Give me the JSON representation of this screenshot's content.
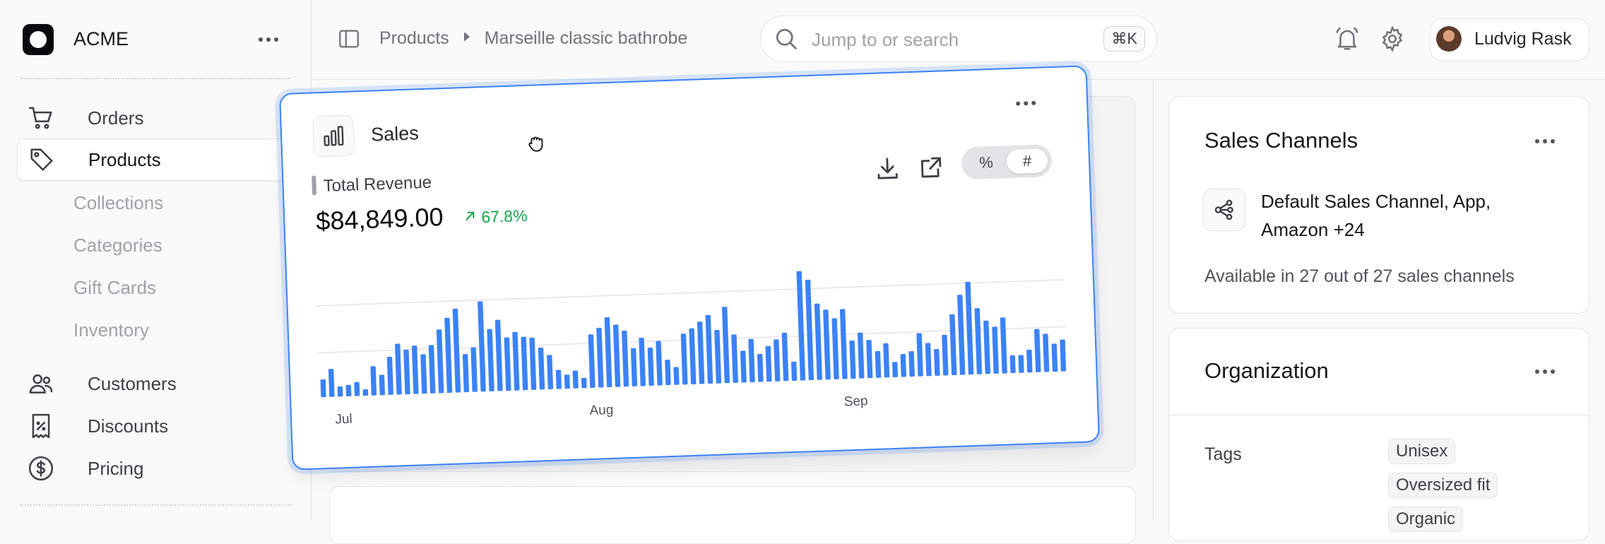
{
  "brand": {
    "name": "ACME"
  },
  "sidebar": {
    "items": [
      {
        "label": "Orders",
        "icon": "cart-icon"
      },
      {
        "label": "Products",
        "icon": "tag-icon",
        "active": true
      },
      {
        "label": "Customers",
        "icon": "users-icon"
      },
      {
        "label": "Discounts",
        "icon": "receipt-percent-icon"
      },
      {
        "label": "Pricing",
        "icon": "currency-dollar-icon"
      }
    ],
    "subitems": [
      "Collections",
      "Categories",
      "Gift Cards",
      "Inventory"
    ]
  },
  "breadcrumb": {
    "items": [
      "Products",
      "Marseille classic bathrobe"
    ]
  },
  "search": {
    "placeholder": "Jump to or search",
    "shortcut": "⌘K"
  },
  "user": {
    "name": "Ludvig Rask"
  },
  "sales_card": {
    "title": "Sales",
    "metric_label": "Total Revenue",
    "value": "$84,849.00",
    "delta": "67.8%",
    "toggle": {
      "options": [
        "%",
        "#"
      ],
      "selected": "#"
    },
    "accent": "#3b82f6"
  },
  "chart_data": {
    "type": "bar",
    "x_tick_labels": [
      "Jul",
      "Aug",
      "Sep"
    ],
    "values": [
      14,
      22,
      8,
      9,
      11,
      5,
      23,
      16,
      30,
      40,
      35,
      38,
      31,
      38,
      50,
      59,
      66,
      30,
      35,
      71,
      49,
      56,
      42,
      46,
      42,
      41,
      33,
      27,
      15,
      11,
      14,
      8,
      42,
      47,
      55,
      49,
      44,
      30,
      38,
      30,
      35,
      20,
      14,
      40,
      44,
      49,
      54,
      42,
      60,
      38,
      25,
      34,
      22,
      28,
      33,
      38,
      15,
      86,
      79,
      60,
      55,
      48,
      55,
      30,
      36,
      30,
      21,
      27,
      12,
      18,
      20,
      34,
      26,
      21,
      32,
      48,
      63,
      73,
      52,
      42,
      37,
      44,
      14,
      14,
      18,
      34,
      30,
      22,
      25
    ],
    "ylim": [
      0,
      100
    ],
    "grid": true,
    "color": "#3b82f6"
  },
  "sales_channels": {
    "title": "Sales Channels",
    "channels_line1": "Default Sales Channel, App,",
    "channels_line2": "Amazon +24",
    "availability": "Available in 27 out of 27 sales channels"
  },
  "organization": {
    "title": "Organization",
    "tags_label": "Tags",
    "tags": [
      "Unisex",
      "Oversized fit",
      "Organic"
    ]
  }
}
